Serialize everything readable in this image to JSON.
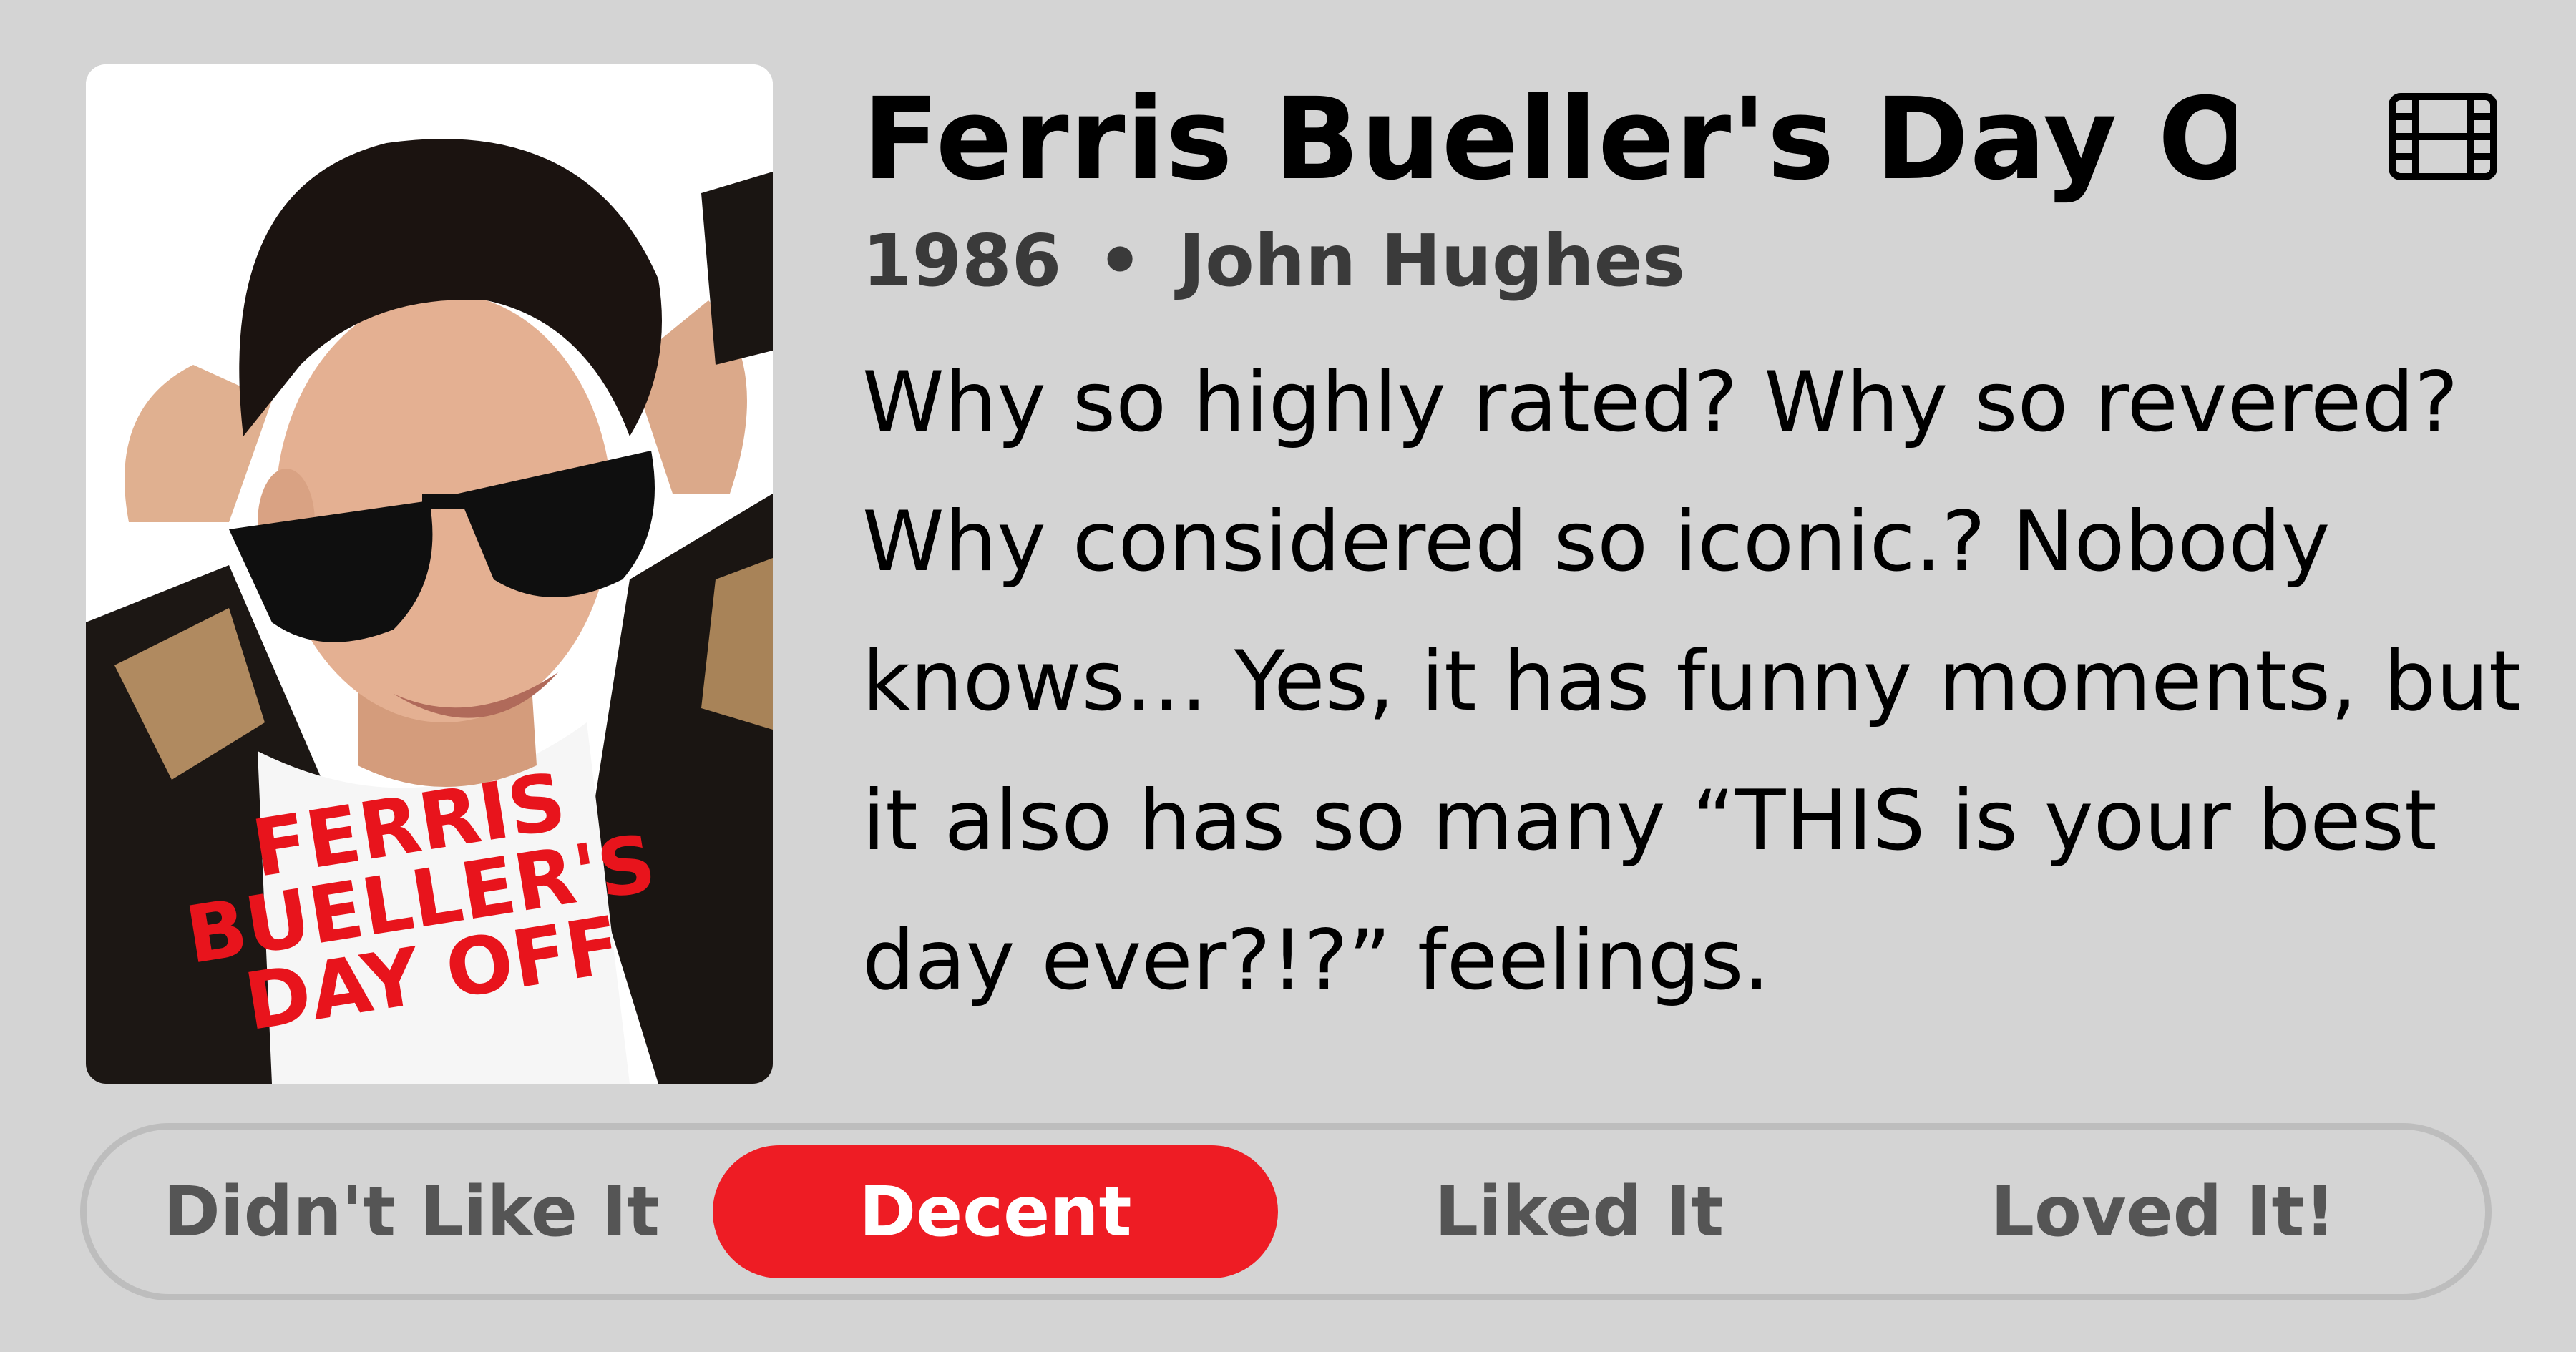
{
  "movie": {
    "title": "Ferris Bueller's Day Of",
    "year": "1986",
    "separator": "•",
    "director": "John Hughes",
    "review": "Why so highly rated? Why so revered? Why considered so iconic.? Nobody knows… Yes, it has funny moments, but it also has so many “THIS is your best day ever?!?” feelings.",
    "type_icon": "film-icon"
  },
  "poster": {
    "text_lines": [
      "FERRIS",
      "BUELLER'S",
      "DAY OFF"
    ],
    "text_color": "#e8141c"
  },
  "rating": {
    "options": [
      "Didn't Like It",
      "Decent",
      "Liked It",
      "Loved It!"
    ],
    "selected": "Decent",
    "accent_color": "#ee1c24"
  }
}
